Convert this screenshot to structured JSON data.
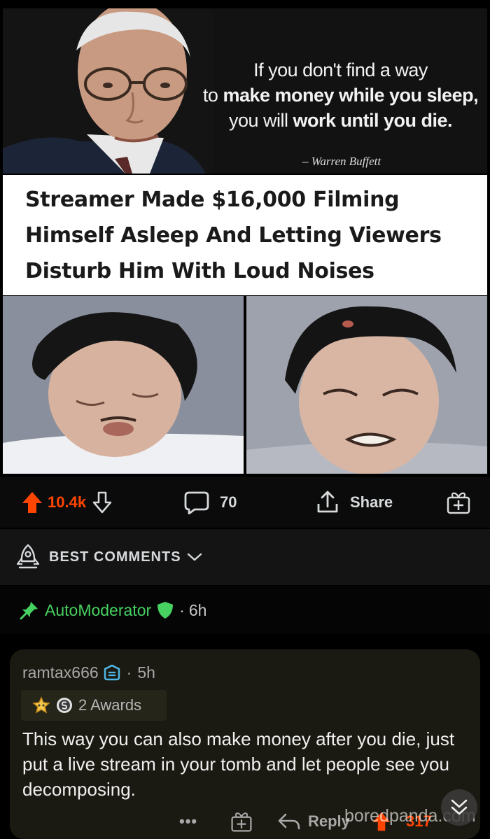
{
  "post": {
    "quote": {
      "line1": "If you don't find a way",
      "line2_plain": "to ",
      "line2_bold": "make money while you sleep,",
      "line3_plain": "you will ",
      "line3_bold": "work until you die.",
      "author": "– Warren Buffett"
    },
    "headline": "Streamer Made $16,000 Filming Himself Asleep And Letting Viewers Disturb Him With Loud Noises"
  },
  "action_bar": {
    "upvotes": "10.4k",
    "comments": "70",
    "share_label": "Share"
  },
  "sort": {
    "label": "BEST COMMENTS"
  },
  "automod": {
    "name": "AutoModerator",
    "separator": "·",
    "time": "6h"
  },
  "comment": {
    "user": "ramtax666",
    "separator": "·",
    "time": "5h",
    "awards": "2 Awards",
    "body": "This way you can also make money after you die, just put a live stream in  your tomb and let people see you decomposing.",
    "more": "•••",
    "reply_label": "Reply",
    "score": "317"
  },
  "watermark": "boredpanda.com",
  "colors": {
    "upvote": "#ff4500",
    "mod_green": "#46d160",
    "background": "#000000"
  }
}
